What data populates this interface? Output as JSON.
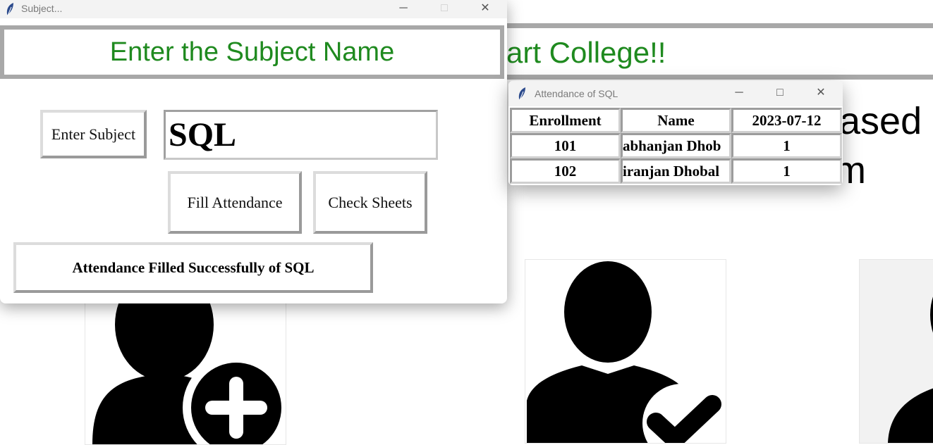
{
  "background_window": {
    "banner_text": "art College!!",
    "heading_line1": "ased",
    "heading_line2": "m"
  },
  "subject_window": {
    "title": "Subject...",
    "header": "Enter the Subject Name",
    "enter_subject_label": "Enter Subject",
    "subject_value": "SQL",
    "fill_attendance_label": "Fill Attendance",
    "check_sheets_label": "Check Sheets",
    "status_message": "Attendance Filled Successfully of SQL",
    "controls": {
      "minimize": "─",
      "maximize": "□",
      "close": "✕"
    }
  },
  "attendance_window": {
    "title": "Attendance of SQL",
    "controls": {
      "minimize": "─",
      "maximize": "□",
      "close": "✕"
    },
    "columns": [
      "Enrollment",
      "Name",
      "2023-07-12"
    ],
    "rows": [
      {
        "enrollment": "101",
        "name": "abhanjan Dhob",
        "mark": "1"
      },
      {
        "enrollment": "102",
        "name": "iranjan Dhobal",
        "mark": "1"
      }
    ]
  },
  "icons": {
    "app_icon": "feather-icon",
    "register_card": "add-user-icon",
    "take_attendance_card": "user-check-icon",
    "view_card": "user-icon"
  },
  "colors": {
    "banner_green": "#1f8a1f",
    "border_gray": "#a0a0a0"
  }
}
